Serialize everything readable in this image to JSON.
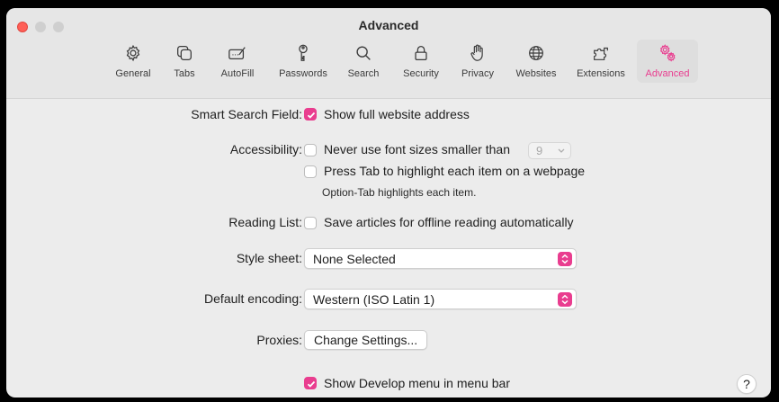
{
  "window": {
    "title": "Advanced"
  },
  "toolbar": {
    "items": [
      {
        "label": "General",
        "icon": "gear-icon"
      },
      {
        "label": "Tabs",
        "icon": "tabs-icon"
      },
      {
        "label": "AutoFill",
        "icon": "autofill-pen-icon"
      },
      {
        "label": "Passwords",
        "icon": "key-icon"
      },
      {
        "label": "Search",
        "icon": "search-icon"
      },
      {
        "label": "Security",
        "icon": "lock-icon"
      },
      {
        "label": "Privacy",
        "icon": "hand-icon"
      },
      {
        "label": "Websites",
        "icon": "globe-icon"
      },
      {
        "label": "Extensions",
        "icon": "puzzle-icon"
      },
      {
        "label": "Advanced",
        "icon": "gears-icon"
      }
    ],
    "active": "Advanced"
  },
  "settings": {
    "smart_search": {
      "label": "Smart Search Field:",
      "option": "Show full website address",
      "checked": true
    },
    "accessibility": {
      "label": "Accessibility:",
      "font_option": "Never use font sizes smaller than",
      "font_size": "9",
      "tab_option": "Press Tab to highlight each item on a webpage",
      "note": "Option-Tab highlights each item."
    },
    "reading_list": {
      "label": "Reading List:",
      "option": "Save articles for offline reading automatically"
    },
    "style_sheet": {
      "label": "Style sheet:",
      "value": "None Selected"
    },
    "encoding": {
      "label": "Default encoding:",
      "value": "Western (ISO Latin 1)"
    },
    "proxies": {
      "label": "Proxies:",
      "button": "Change Settings..."
    },
    "develop": {
      "option": "Show Develop menu in menu bar",
      "checked": true
    }
  },
  "help": {
    "label": "?"
  },
  "colors": {
    "accent": "#e93d8f"
  }
}
